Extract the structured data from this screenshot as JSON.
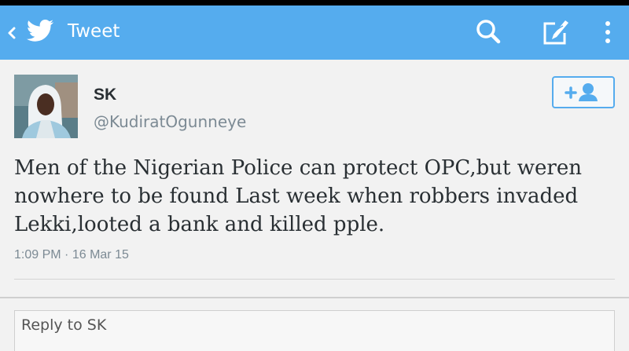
{
  "header": {
    "title": "Tweet",
    "background_color": "#55acee",
    "icons": [
      "back-chevron-icon",
      "twitter-bird-icon",
      "search-icon",
      "compose-icon",
      "overflow-menu-icon"
    ]
  },
  "tweet": {
    "user_name": "SK",
    "user_handle": "@KudiratOgunneye",
    "text": "Men of the Nigerian Police can protect OPC,but weren nowhere to be found Last week when robbers invaded Lekki,looted a bank and killed pple.",
    "time": "1:09 PM",
    "date": "16 Mar 15",
    "follow_icon": "add-user-icon"
  },
  "reply": {
    "placeholder": "Reply to SK"
  }
}
